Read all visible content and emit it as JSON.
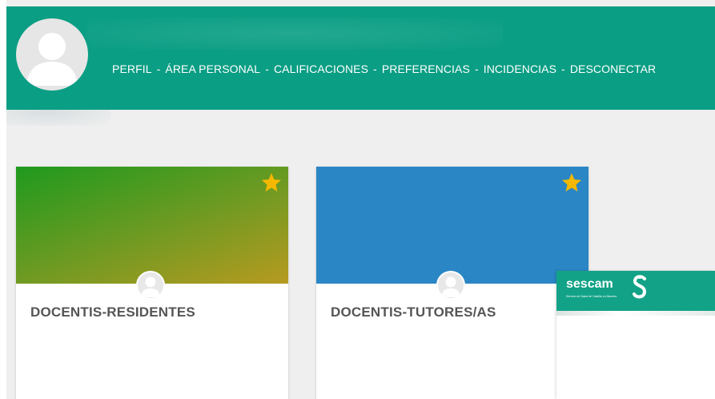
{
  "header": {
    "nav": [
      {
        "label": "PERFIL"
      },
      {
        "label": "ÁREA PERSONAL"
      },
      {
        "label": "CALIFICACIONES"
      },
      {
        "label": "PREFERENCIAS"
      },
      {
        "label": "INCIDENCIAS"
      },
      {
        "label": "DESCONECTAR"
      }
    ],
    "separator": "-",
    "avatar_icon": "user-avatar-icon"
  },
  "courses": [
    {
      "title": "DOCENTIS-RESIDENTES",
      "favorite": true,
      "banner_colors": [
        "#1e9a1e",
        "#b79a20"
      ]
    },
    {
      "title": "DOCENTIS-TUTORES/AS",
      "favorite": true,
      "banner_color": "#2a86c4"
    }
  ],
  "sescam": {
    "brand": "sescam",
    "tagline": "Servicio de Salud de Castilla-La Mancha",
    "logo_icon": "sescam-s-logo-icon"
  },
  "colors": {
    "header": "#0a9e84",
    "star": "#f5b800",
    "card_title": "#555555"
  }
}
